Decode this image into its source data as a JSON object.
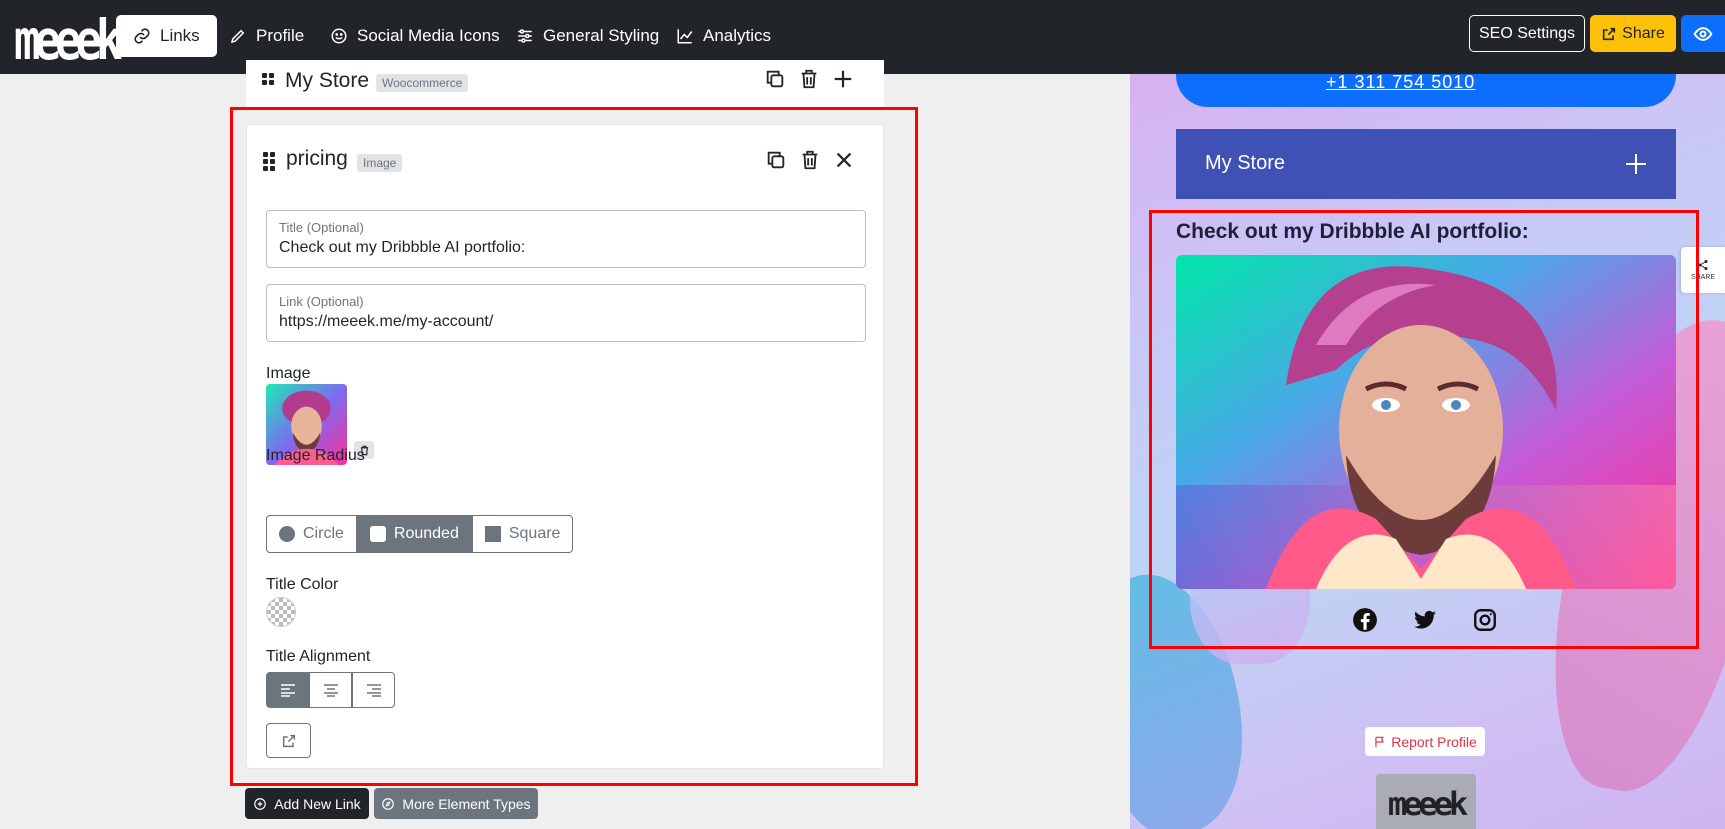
{
  "navbar": {
    "logo": "meeek",
    "tabs": [
      {
        "label": "Links",
        "icon": "link-icon",
        "active": true
      },
      {
        "label": "Profile",
        "icon": "pencil-icon"
      },
      {
        "label": "Social Media Icons",
        "icon": "smiley-icon"
      },
      {
        "label": "General Styling",
        "icon": "sliders-icon"
      },
      {
        "label": "Analytics",
        "icon": "chart-line-icon"
      }
    ],
    "seo_label": "SEO Settings",
    "share_label": "Share",
    "preview_icon": "eye-icon"
  },
  "editor": {
    "collapsed_card": {
      "title": "My Store",
      "badge": "Woocommerce"
    },
    "active_card": {
      "title": "pricing",
      "badge": "Image",
      "title_field": {
        "label": "Title (Optional)",
        "value": "Check out my Dribbble AI portfolio:"
      },
      "link_field": {
        "label": "Link (Optional)",
        "value": "https://meeek.me/my-account/"
      },
      "image_label": "Image",
      "image_radius_label": "Image Radius",
      "radius_options": [
        "Circle",
        "Rounded",
        "Square"
      ],
      "radius_selected": "Rounded",
      "title_color_label": "Title Color",
      "title_alignment_label": "Title Alignment",
      "alignment_selected": "left"
    },
    "add_link_label": "Add New Link",
    "more_types_label": "More Element Types"
  },
  "preview": {
    "phone_text": "+1 311 754 5010",
    "store_title": "My Store",
    "image_title": "Check out my Dribbble AI portfolio:",
    "social_icons": [
      "facebook-icon",
      "twitter-icon",
      "instagram-icon"
    ],
    "report_label": "Report Profile",
    "footer_logo": "meeek",
    "share_tab_label": "SHARE"
  },
  "colors": {
    "navbar_bg": "#212529",
    "accent_blue": "#0d6efd",
    "share_yellow": "#ffc107",
    "store_button": "#3f51b5",
    "highlight": "#ff0000"
  }
}
